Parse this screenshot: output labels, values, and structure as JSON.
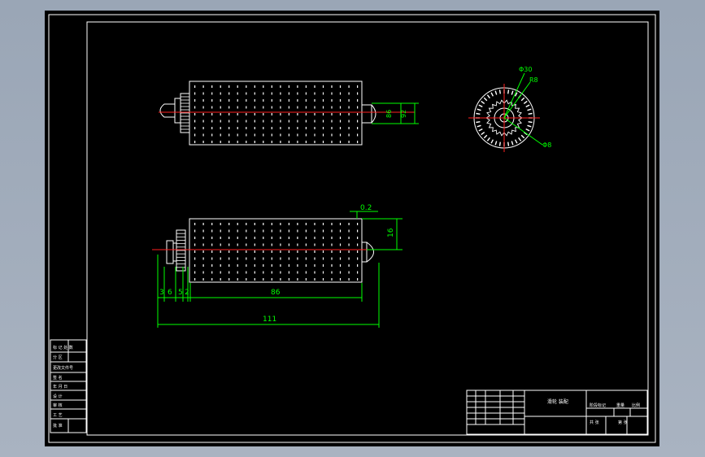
{
  "colors": {
    "background_outer": "#a3adbb",
    "sheet": "#000000",
    "frame": "#ffffff",
    "centerline": "#ff2020",
    "dimension": "#00ff00"
  },
  "drawing": {
    "top_view": {
      "dims": {
        "left": "86",
        "right": "92"
      }
    },
    "side_view": {
      "labels": {
        "top": "Φ30",
        "mid": "R8",
        "bottom": "Φ8"
      }
    },
    "front_view": {
      "dims": {
        "gap": "0.2",
        "height": "16",
        "d1": "3",
        "d2": "6",
        "d3": "5",
        "d4": "2",
        "body": "86",
        "total": "111"
      }
    }
  },
  "left_strip": {
    "rows": [
      "标 记 处 数",
      "分 区",
      "更改文件号",
      "签 名",
      "年 月 日",
      "设 计",
      "审 核",
      "工 艺",
      "批 准"
    ]
  },
  "title_block": {
    "part_name": "滑轮\n装配",
    "cells": [
      "阶段标记",
      "重量",
      "比例",
      "共 张",
      "第 张"
    ]
  }
}
